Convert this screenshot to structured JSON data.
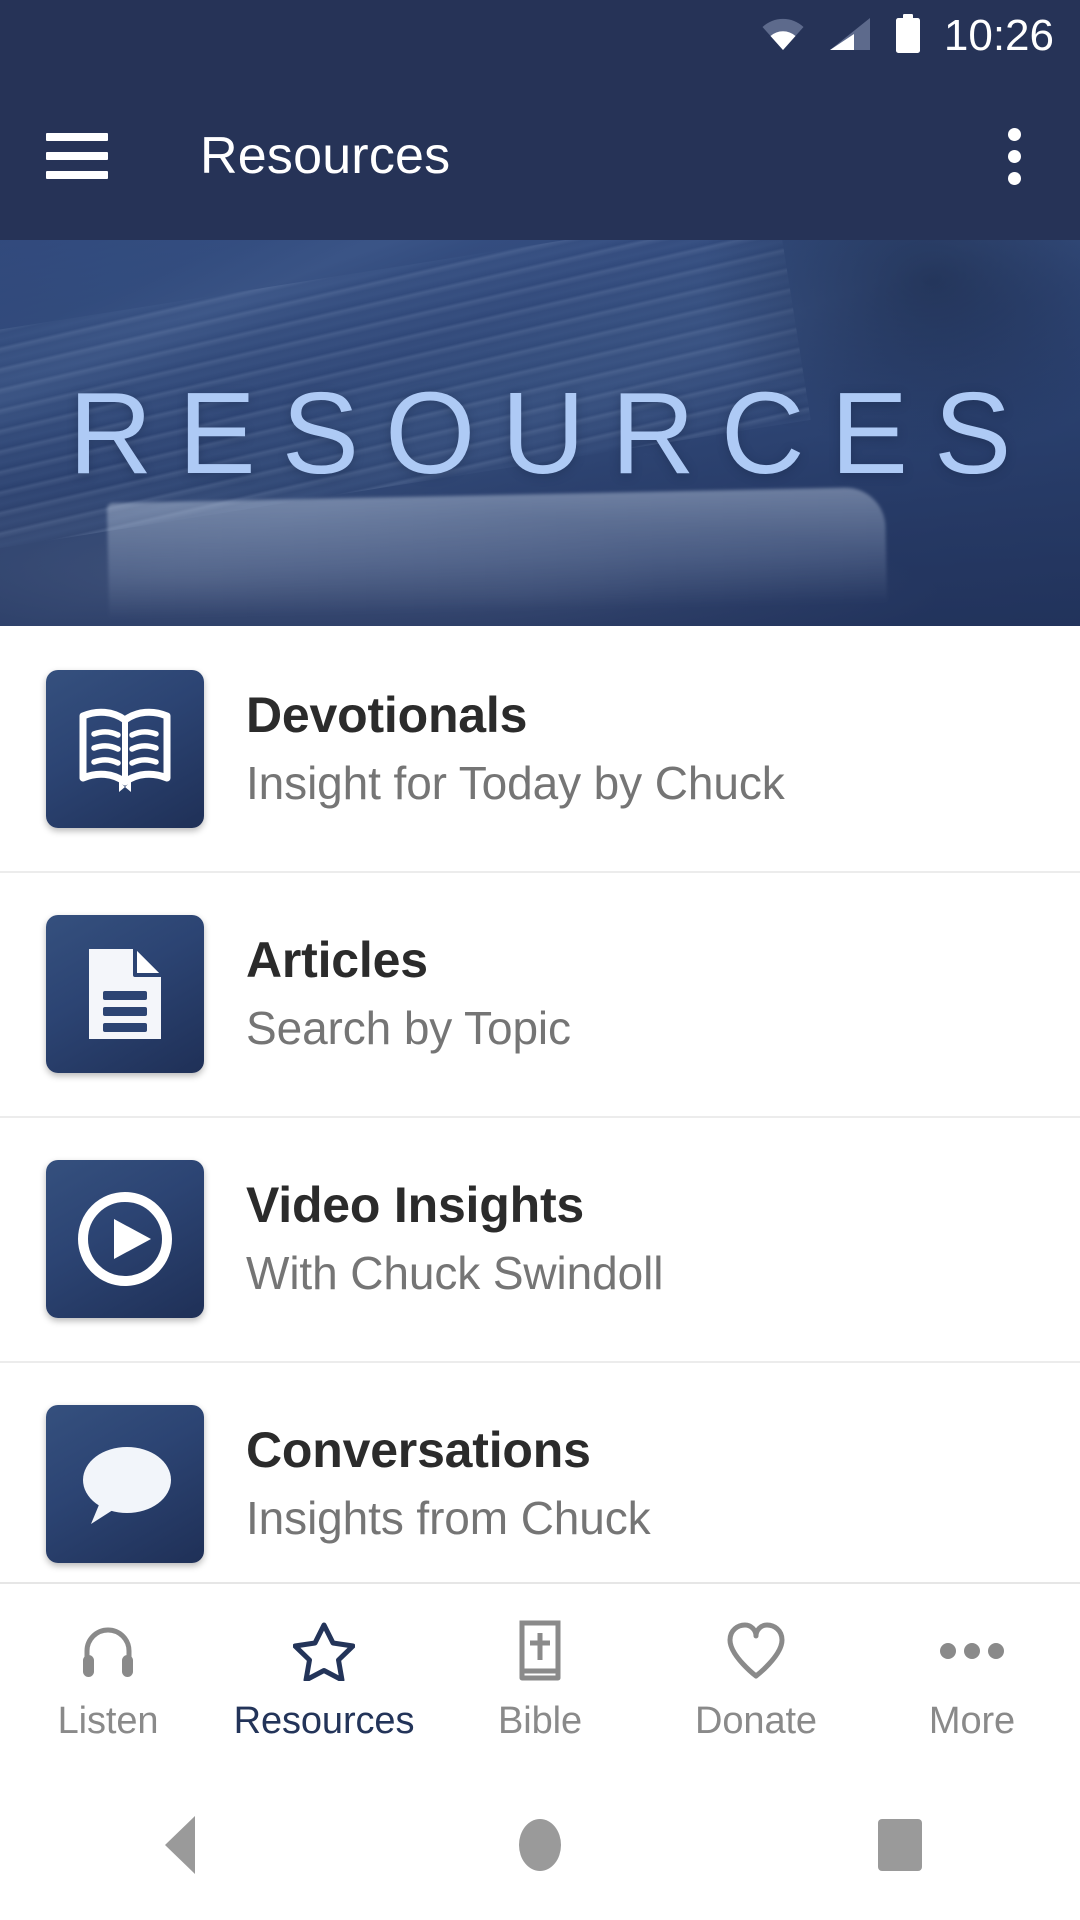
{
  "status_bar": {
    "time": "10:26",
    "icons": [
      "wifi-icon",
      "cellular-signal-icon",
      "battery-icon"
    ]
  },
  "app_bar": {
    "menu_icon": "hamburger-menu-icon",
    "title": "Resources",
    "overflow_icon": "overflow-menu-icon"
  },
  "hero": {
    "title": "RESOURCES",
    "title_color": "#aecaf5",
    "background_description": "open-book-photo-blue-tint"
  },
  "theme": {
    "app_bar_bg": "#263357",
    "tile_gradient_start": "#35507e",
    "tile_gradient_end": "#1f3057",
    "active_nav": "#233459",
    "inactive_nav": "#8a8a8a",
    "title_text": "#2b2b2b",
    "subtitle_text": "#757575",
    "divider": "#ececec"
  },
  "list": {
    "items": [
      {
        "icon": "open-book-icon",
        "title": "Devotionals",
        "subtitle": "Insight for Today by Chuck"
      },
      {
        "icon": "document-icon",
        "title": "Articles",
        "subtitle": "Search by Topic"
      },
      {
        "icon": "play-circle-icon",
        "title": "Video Insights",
        "subtitle": "With Chuck Swindoll"
      },
      {
        "icon": "speech-bubble-icon",
        "title": "Conversations",
        "subtitle": "Insights from Chuck"
      }
    ]
  },
  "bottom_nav": {
    "items": [
      {
        "icon": "headphones-icon",
        "label": "Listen",
        "active": false
      },
      {
        "icon": "star-icon",
        "label": "Resources",
        "active": true
      },
      {
        "icon": "bible-book-icon",
        "label": "Bible",
        "active": false
      },
      {
        "icon": "heart-icon",
        "label": "Donate",
        "active": false
      },
      {
        "icon": "more-ellipsis-icon",
        "label": "More",
        "active": false
      }
    ]
  },
  "system_nav": {
    "back": "back-triangle-icon",
    "home": "home-circle-icon",
    "recents": "recents-square-icon"
  }
}
